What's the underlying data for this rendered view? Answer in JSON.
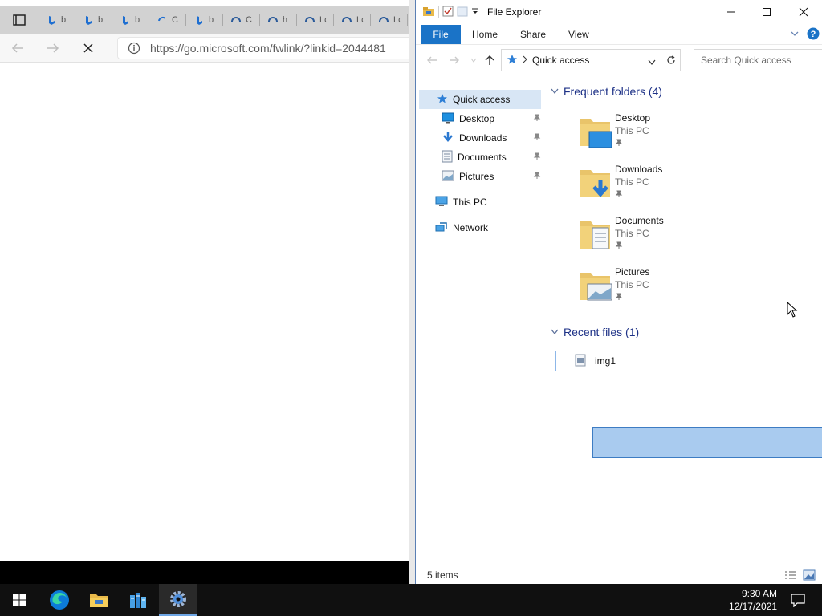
{
  "browser": {
    "tabs": [
      {
        "label": "b",
        "icon": "bing-icon"
      },
      {
        "label": "b",
        "icon": "bing-icon"
      },
      {
        "label": "b",
        "icon": "bing-icon"
      },
      {
        "label": "C",
        "icon": "loading-icon"
      },
      {
        "label": "b",
        "icon": "bing-icon"
      },
      {
        "label": "C",
        "icon": "loading-icon"
      },
      {
        "label": "h",
        "icon": "loading-icon"
      },
      {
        "label": "Lc",
        "icon": "loading-icon"
      },
      {
        "label": "Lc",
        "icon": "loading-icon"
      },
      {
        "label": "Lc",
        "icon": "loading-icon"
      }
    ],
    "url": "https://go.microsoft.com/fwlink/?linkid=2044481"
  },
  "explorer": {
    "title": "File Explorer",
    "ribbon_tabs": [
      "File",
      "Home",
      "Share",
      "View"
    ],
    "address": "Quick access",
    "search_placeholder": "Search Quick access",
    "nav": {
      "quick_access": "Quick access",
      "pinned": [
        "Desktop",
        "Downloads",
        "Documents",
        "Pictures"
      ],
      "this_pc": "This PC",
      "network": "Network"
    },
    "frequent_header": "Frequent folders (4)",
    "frequent": [
      {
        "name": "Desktop",
        "location": "This PC"
      },
      {
        "name": "Downloads",
        "location": "This PC"
      },
      {
        "name": "Documents",
        "location": "This PC"
      },
      {
        "name": "Pictures",
        "location": "This PC"
      }
    ],
    "recent_header": "Recent files (1)",
    "recent": [
      {
        "name": "img1"
      }
    ],
    "status": "5 items"
  },
  "taskbar": {
    "time": "9:30 AM",
    "date": "12/17/2021"
  },
  "colors": {
    "accent": "#1a73c7",
    "selection": "#a9cbef",
    "group_header": "#1e3287"
  }
}
